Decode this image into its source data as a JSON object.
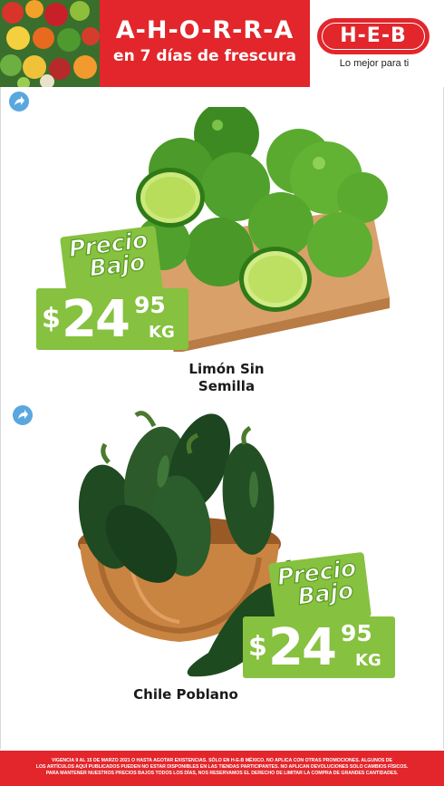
{
  "header": {
    "banner_title": "A-H-O-R-R-A",
    "banner_subtitle": "en 7 días de frescura",
    "logo_text": "H-E-B",
    "tagline": "Lo mejor para ti",
    "brand_red": "#e2262b"
  },
  "products": [
    {
      "name_line1": "Limón Sin",
      "name_line2": "Semilla",
      "badge_line1": "Precio",
      "badge_line2": "Bajo",
      "currency": "$",
      "price_int": "24",
      "price_dec": "95",
      "unit": "KG",
      "share_icon": "share-arrow-icon"
    },
    {
      "name_line1": "Chile Poblano",
      "badge_line1": "Precio",
      "badge_line2": "Bajo",
      "currency": "$",
      "price_int": "24",
      "price_dec": "95",
      "unit": "KG",
      "share_icon": "share-arrow-icon"
    }
  ],
  "footer": {
    "legal_line1": "VIGENCIA 9 AL 15 DE MARZO 2021 O HASTA AGOTAR EXISTENCIAS. SÓLO EN H-E-B MÉXICO. NO APLICA CON OTRAS PROMOCIONES. ALGUNOS DE",
    "legal_line2": "LOS ARTÍCULOS AQUÍ PUBLICADOS PUEDEN NO ESTAR DISPONIBLES EN LAS TIENDAS PARTICIPANTES. NO APLICAN DEVOLUCIONES SOLO CAMBIOS FÍSICOS.",
    "legal_line3": "PARA MANTENER NUESTROS PRECIOS BAJOS TODOS LOS DÍAS, NOS RESERVAMOS EL DERECHO DE LIMITAR LA COMPRA DE GRANDES CANTIDADES."
  },
  "colors": {
    "price_green": "#86c13f",
    "share_blue": "#5aa7e0"
  }
}
